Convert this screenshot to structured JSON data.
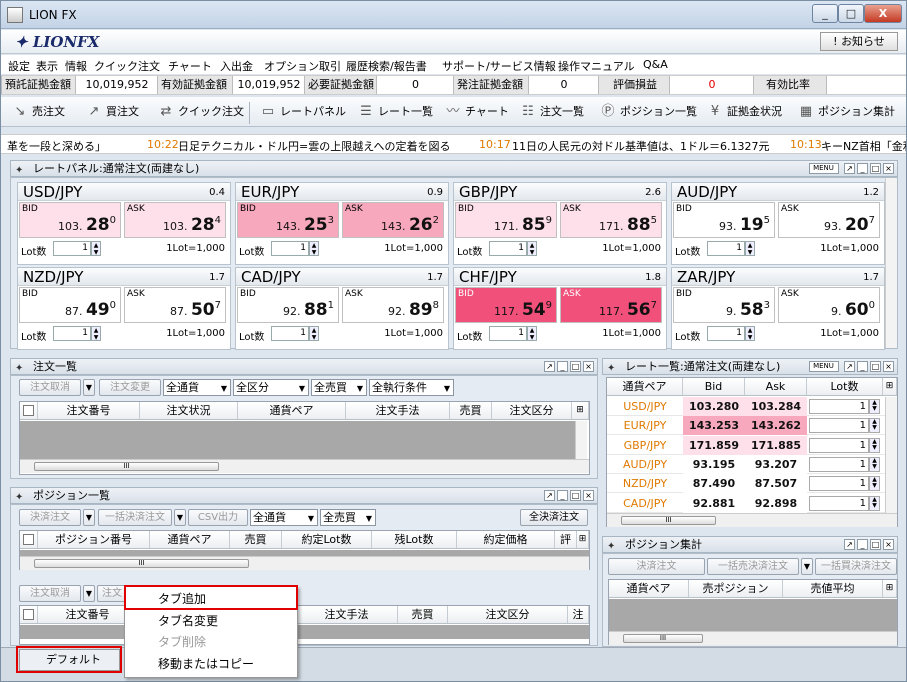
{
  "window": {
    "title": "LION FX",
    "min": "_",
    "max": "□",
    "close": "X"
  },
  "logo": "LIONFX",
  "notice_button": "! お知らせ",
  "menu": [
    "設定",
    "表示",
    "情報",
    "クイック注文",
    "チャート",
    "入出金",
    "オプション取引",
    "履歴検索/報告書",
    "サポート/サービス情報",
    "操作マニュアル",
    "Q&A"
  ],
  "account": {
    "items": [
      {
        "label": "預託証拠金額",
        "value": "10,019,952"
      },
      {
        "label": "有効証拠金額",
        "value": "10,019,952"
      },
      {
        "label": "必要証拠金額",
        "value": "0"
      },
      {
        "label": "発注証拠金額",
        "value": "0"
      },
      {
        "label": "評価損益",
        "value": "0"
      },
      {
        "label": "有効比率",
        "value": ""
      }
    ]
  },
  "toolbar": [
    "売注文",
    "買注文",
    "クイック注文",
    "レートパネル",
    "レート一覧",
    "チャート",
    "注文一覧",
    "ポジション一覧",
    "証拠金状況",
    "ポジション集計"
  ],
  "news": [
    {
      "time": "",
      "text": "革を一段と深める」"
    },
    {
      "time": "10:22",
      "text": "日足テクニカル・ドル円=雲の上限越えへの定着を図る"
    },
    {
      "time": "10:17",
      "text": "11日の人民元の対ドル基準値は、1ドル＝6.1327元"
    },
    {
      "time": "10:13",
      "text": "キーNZ首相「金利"
    }
  ],
  "rate_panel": {
    "title": "レートパネル:通常注文(両建なし)",
    "menu_label": "MENU",
    "bid_label": "BID",
    "ask_label": "ASK",
    "lot_label": "Lot数",
    "lot_unit": "1Lot=1,000",
    "tiles": [
      {
        "pair": "USD/JPY",
        "spread": "0.4",
        "bid": [
          "103.",
          "28",
          "0"
        ],
        "ask": [
          "103.",
          "28",
          "4"
        ],
        "lot": "1"
      },
      {
        "pair": "EUR/JPY",
        "spread": "0.9",
        "bid": [
          "143.",
          "25",
          "3"
        ],
        "ask": [
          "143.",
          "26",
          "2"
        ],
        "lot": "1"
      },
      {
        "pair": "GBP/JPY",
        "spread": "2.6",
        "bid": [
          "171.",
          "85",
          "9"
        ],
        "ask": [
          "171.",
          "88",
          "5"
        ],
        "lot": "1"
      },
      {
        "pair": "AUD/JPY",
        "spread": "1.2",
        "bid": [
          "93.",
          "19",
          "5"
        ],
        "ask": [
          "93.",
          "20",
          "7"
        ],
        "lot": "1"
      },
      {
        "pair": "NZD/JPY",
        "spread": "1.7",
        "bid": [
          "87.",
          "49",
          "0"
        ],
        "ask": [
          "87.",
          "50",
          "7"
        ],
        "lot": "1"
      },
      {
        "pair": "CAD/JPY",
        "spread": "1.7",
        "bid": [
          "92.",
          "88",
          "1"
        ],
        "ask": [
          "92.",
          "89",
          "8"
        ],
        "lot": "1"
      },
      {
        "pair": "CHF/JPY",
        "spread": "1.8",
        "bid": [
          "117.",
          "54",
          "9"
        ],
        "ask": [
          "117.",
          "56",
          "7"
        ],
        "lot": "1"
      },
      {
        "pair": "ZAR/JPY",
        "spread": "1.7",
        "bid": [
          "9.",
          "58",
          "3"
        ],
        "ask": [
          "9.",
          "60",
          "0"
        ],
        "lot": "1"
      }
    ]
  },
  "order_list": {
    "title": "注文一覧",
    "buttons": [
      "注文取消",
      "注文変更"
    ],
    "filters": [
      "全通貨",
      "全区分",
      "全売買",
      "全執行条件"
    ],
    "columns": [
      "注文番号",
      "注文状況",
      "通貨ペア",
      "注文手法",
      "売買",
      "注文区分"
    ],
    "scroll": "III"
  },
  "position_list": {
    "title": "ポジション一覧",
    "buttons": [
      "決済注文",
      "一括決済注文",
      "CSV出力"
    ],
    "filters": [
      "全通貨",
      "全売買"
    ],
    "close_all": "全決済注文",
    "columns": [
      "ポジション番号",
      "通貨ペア",
      "売買",
      "約定Lot数",
      "残Lot数",
      "約定価格",
      "評価"
    ],
    "scroll": "III"
  },
  "lower_order": {
    "buttons": [
      "注文取消",
      "注文"
    ],
    "columns": [
      "注文番号",
      "注文手法",
      "売買",
      "注文区分",
      "注"
    ]
  },
  "rate_list": {
    "title": "レート一覧:通常注文(両建なし)",
    "menu_label": "MENU",
    "columns": [
      "通貨ペア",
      "Bid",
      "Ask",
      "Lot数"
    ],
    "rows": [
      {
        "pair": "USD/JPY",
        "bid": "103.280",
        "ask": "103.284",
        "lot": "1"
      },
      {
        "pair": "EUR/JPY",
        "bid": "143.253",
        "ask": "143.262",
        "lot": "1"
      },
      {
        "pair": "GBP/JPY",
        "bid": "171.859",
        "ask": "171.885",
        "lot": "1"
      },
      {
        "pair": "AUD/JPY",
        "bid": "93.195",
        "ask": "93.207",
        "lot": "1"
      },
      {
        "pair": "NZD/JPY",
        "bid": "87.490",
        "ask": "87.507",
        "lot": "1"
      },
      {
        "pair": "CAD/JPY",
        "bid": "92.881",
        "ask": "92.898",
        "lot": "1"
      }
    ],
    "scroll": "III"
  },
  "position_summary": {
    "title": "ポジション集計",
    "buttons": [
      "決済注文",
      "一括売決済注文",
      "一括買決済注文"
    ],
    "columns": [
      "通貨ペア",
      "売ポジション",
      "売値平均"
    ],
    "scroll": "III"
  },
  "context_menu": [
    "タブ追加",
    "タブ名変更",
    "タブ削除",
    "移動またはコピー"
  ],
  "default_tab": "デフォルト",
  "colors": {
    "highlight_red": "#e00000",
    "chf_pink": "#f0507a",
    "eur_pink": "#f7a8bd",
    "pale_pink": "#fde0ea",
    "pair_orange": "#e07a00"
  }
}
